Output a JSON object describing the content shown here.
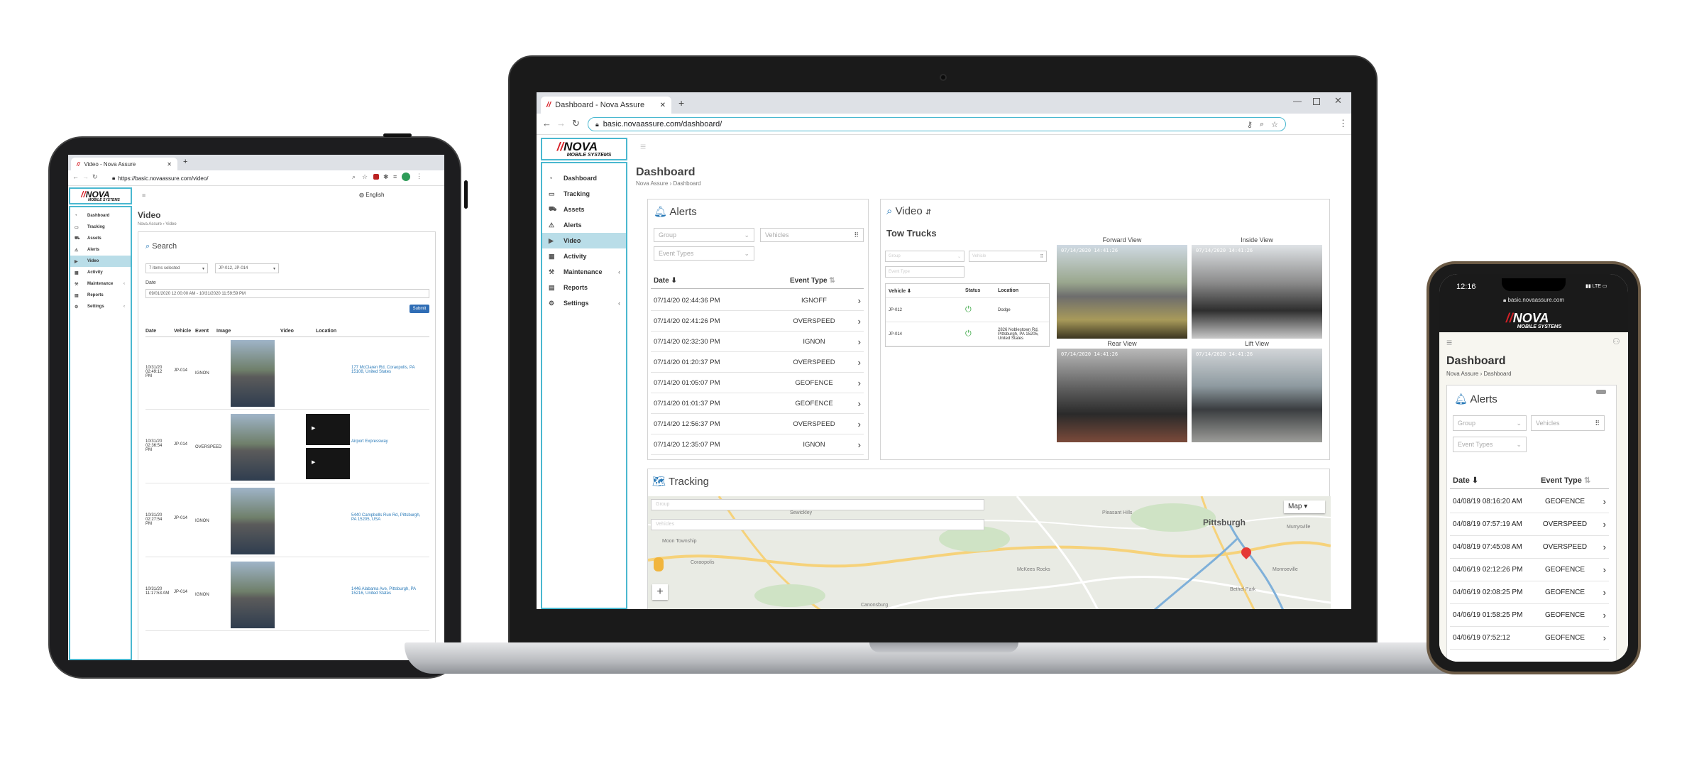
{
  "tablet": {
    "tab_title": "Video - Nova Assure",
    "url": "https://basic.novaassure.com/video/",
    "language": "English",
    "logo": {
      "text": "NOVA",
      "sub": "MOBILE SYSTEMS"
    },
    "nav": [
      {
        "label": "Dashboard",
        "icon": "dashboard-icon"
      },
      {
        "label": "Tracking",
        "icon": "map-icon"
      },
      {
        "label": "Assets",
        "icon": "truck-icon"
      },
      {
        "label": "Alerts",
        "icon": "warning-icon"
      },
      {
        "label": "Video",
        "icon": "video-icon"
      },
      {
        "label": "Activity",
        "icon": "calendar-icon"
      },
      {
        "label": "Maintenance",
        "icon": "wrench-icon"
      },
      {
        "label": "Reports",
        "icon": "book-icon"
      },
      {
        "label": "Settings",
        "icon": "gear-icon"
      }
    ],
    "page_title": "Video",
    "breadcrumb": [
      "Nova Assure",
      "Video"
    ],
    "search_title": "Search",
    "filter1": "7 items selected",
    "filter2": "JP-012, JP-014",
    "date_label": "Date",
    "date_value": "09/01/2020 12:00:00 AM - 10/31/2020 11:59:59 PM",
    "submit": "Submit",
    "columns": [
      "Date",
      "Vehicle",
      "Event",
      "Image",
      "Video",
      "Location"
    ],
    "rows": [
      {
        "date": "10/31/20 02:49:12 PM",
        "vehicle": "JP-014",
        "event": "IGNON",
        "location": "177 McClaren Rd, Coraopolis, PA 15108, United States"
      },
      {
        "date": "10/31/20 02:36:54 PM",
        "vehicle": "JP-014",
        "event": "OVERSPEED",
        "location": "Airport Expressway"
      },
      {
        "date": "10/31/20 02:27:54 PM",
        "vehicle": "JP-014",
        "event": "IGNON",
        "location": "5440 Campbells Run Rd, Pittsburgh, PA 15205, USA"
      },
      {
        "date": "10/31/20 11:17:53 AM",
        "vehicle": "JP-014",
        "event": "IGNON",
        "location": "1446 Alabama Ave, Pittsburgh, PA 15216, United States"
      }
    ]
  },
  "laptop": {
    "tab_title": "Dashboard - Nova Assure",
    "url": "basic.novaassure.com/dashboard/",
    "logo": {
      "text": "NOVA",
      "sub": "MOBILE SYSTEMS"
    },
    "nav": [
      {
        "label": "Dashboard",
        "icon": "dashboard-icon"
      },
      {
        "label": "Tracking",
        "icon": "map-icon"
      },
      {
        "label": "Assets",
        "icon": "truck-icon"
      },
      {
        "label": "Alerts",
        "icon": "warning-icon"
      },
      {
        "label": "Video",
        "icon": "video-icon"
      },
      {
        "label": "Activity",
        "icon": "calendar-icon"
      },
      {
        "label": "Maintenance",
        "icon": "wrench-icon"
      },
      {
        "label": "Reports",
        "icon": "book-icon"
      },
      {
        "label": "Settings",
        "icon": "gear-icon"
      }
    ],
    "page_title": "Dashboard",
    "breadcrumb": [
      "Nova Assure",
      "Dashboard"
    ],
    "alerts": {
      "title": "Alerts",
      "group_placeholder": "Group",
      "vehicles_placeholder": "Vehicles",
      "event_types_placeholder": "Event Types",
      "col_date": "Date",
      "col_event": "Event Type",
      "rows": [
        {
          "date": "07/14/20 02:44:36 PM",
          "event": "IGNOFF"
        },
        {
          "date": "07/14/20 02:41:26 PM",
          "event": "OVERSPEED"
        },
        {
          "date": "07/14/20 02:32:30 PM",
          "event": "IGNON"
        },
        {
          "date": "07/14/20 01:20:37 PM",
          "event": "OVERSPEED"
        },
        {
          "date": "07/14/20 01:05:07 PM",
          "event": "GEOFENCE"
        },
        {
          "date": "07/14/20 01:01:37 PM",
          "event": "GEOFENCE"
        },
        {
          "date": "07/14/20 12:56:37 PM",
          "event": "OVERSPEED"
        },
        {
          "date": "07/14/20 12:35:07 PM",
          "event": "IGNON"
        }
      ]
    },
    "video": {
      "title": "Video",
      "group_name": "Tow Trucks",
      "group_placeholder": "Group",
      "vehicle_placeholder": "Vehicle",
      "event_type_placeholder": "Event Type",
      "col_vehicle": "Vehicle",
      "col_status": "Status",
      "col_location": "Location",
      "vehicles": [
        {
          "id": "JP-012",
          "location": "Dodge"
        },
        {
          "id": "JP-014",
          "location": "2826 Noblestown Rd, Pittsburgh, PA 15205, United States"
        }
      ],
      "views": [
        {
          "label": "Forward View",
          "stamp": "07/14/2020 14:41:26"
        },
        {
          "label": "Inside View",
          "stamp": "07/14/2020 14:41:26"
        },
        {
          "label": "Rear View",
          "stamp": "07/14/2020 14:41:26"
        },
        {
          "label": "Lift View",
          "stamp": "07/14/2020 14:41:26"
        }
      ]
    },
    "tracking": {
      "title": "Tracking",
      "group_placeholder": "Group",
      "vehicles_placeholder": "Vehicles",
      "map_type": "Map",
      "city": "Pittsburgh",
      "places": [
        "Pleasant Hills",
        "Bethel Park",
        "Coraopolis",
        "Moon Township",
        "Canonsburg",
        "McKees Rocks",
        "Sewickley",
        "Monroeville",
        "Murrysville"
      ]
    }
  },
  "phone": {
    "time": "12:16",
    "network": "LTE",
    "url": "basic.novaassure.com",
    "logo": {
      "text": "NOVA",
      "sub": "MOBILE SYSTEMS"
    },
    "page_title": "Dashboard",
    "breadcrumb": [
      "Nova Assure",
      "Dashboard"
    ],
    "alerts_title": "Alerts",
    "group_placeholder": "Group",
    "vehicles_placeholder": "Vehicles",
    "event_types_placeholder": "Event Types",
    "col_date": "Date",
    "col_event": "Event Type",
    "rows": [
      {
        "date": "04/08/19 08:16:20 AM",
        "event": "GEOFENCE"
      },
      {
        "date": "04/08/19 07:57:19 AM",
        "event": "OVERSPEED"
      },
      {
        "date": "04/08/19 07:45:08 AM",
        "event": "OVERSPEED"
      },
      {
        "date": "04/06/19 02:12:26 PM",
        "event": "GEOFENCE"
      },
      {
        "date": "04/06/19 02:08:25 PM",
        "event": "GEOFENCE"
      },
      {
        "date": "04/06/19 01:58:25 PM",
        "event": "GEOFENCE"
      },
      {
        "date": "04/06/19 07:52:12",
        "event": "GEOFENCE"
      }
    ]
  },
  "colors": {
    "accent": "#4ab8d0",
    "logo_red": "#d62027",
    "active_nav": "#b9dde8",
    "link": "#2a7ab8"
  }
}
